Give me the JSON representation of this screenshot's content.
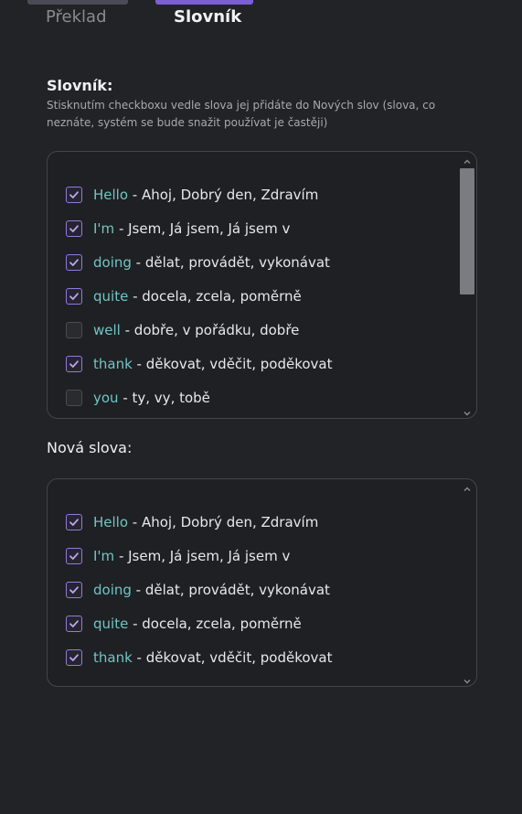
{
  "tabs": {
    "translate": "Překlad",
    "dictionary": "Slovník"
  },
  "dictionary": {
    "title": "Slovník:",
    "description": "Stisknutím checkboxu vedle slova jej přidáte do Nových slov (slova, co neznáte, systém se bude snažit používat je častěji)",
    "separator": " - ",
    "items": [
      {
        "word": "Hello",
        "translation": "Ahoj, Dobrý den, Zdravím",
        "checked": true
      },
      {
        "word": "I'm",
        "translation": "Jsem, Já jsem, Já jsem v",
        "checked": true
      },
      {
        "word": "doing",
        "translation": "dělat, provádět, vykonávat",
        "checked": true
      },
      {
        "word": "quite",
        "translation": "docela, zcela, poměrně",
        "checked": true
      },
      {
        "word": "well",
        "translation": "dobře, v pořádku, dobře",
        "checked": false
      },
      {
        "word": "thank",
        "translation": "děkovat, vděčit, poděkovat",
        "checked": true
      },
      {
        "word": "you",
        "translation": "ty, vy, tobě",
        "checked": false
      }
    ]
  },
  "new_words": {
    "title": "Nová slova:",
    "separator": " - ",
    "items": [
      {
        "word": "Hello",
        "translation": "Ahoj, Dobrý den, Zdravím",
        "checked": true
      },
      {
        "word": "I'm",
        "translation": "Jsem, Já jsem, Já jsem v",
        "checked": true
      },
      {
        "word": "doing",
        "translation": "dělat, provádět, vykonávat",
        "checked": true
      },
      {
        "word": "quite",
        "translation": "docela, zcela, poměrně",
        "checked": true
      },
      {
        "word": "thank",
        "translation": "děkovat, vděčit, poděkovat",
        "checked": true
      }
    ]
  },
  "colors": {
    "background": "#222326",
    "accent": "#7a5fd6",
    "word": "#6fc5c4",
    "checkbox_checked": "#8f7be0"
  },
  "icons": {
    "checkbox": "check-icon",
    "scroll_up": "chevron-up-icon",
    "scroll_down": "chevron-down-icon"
  }
}
